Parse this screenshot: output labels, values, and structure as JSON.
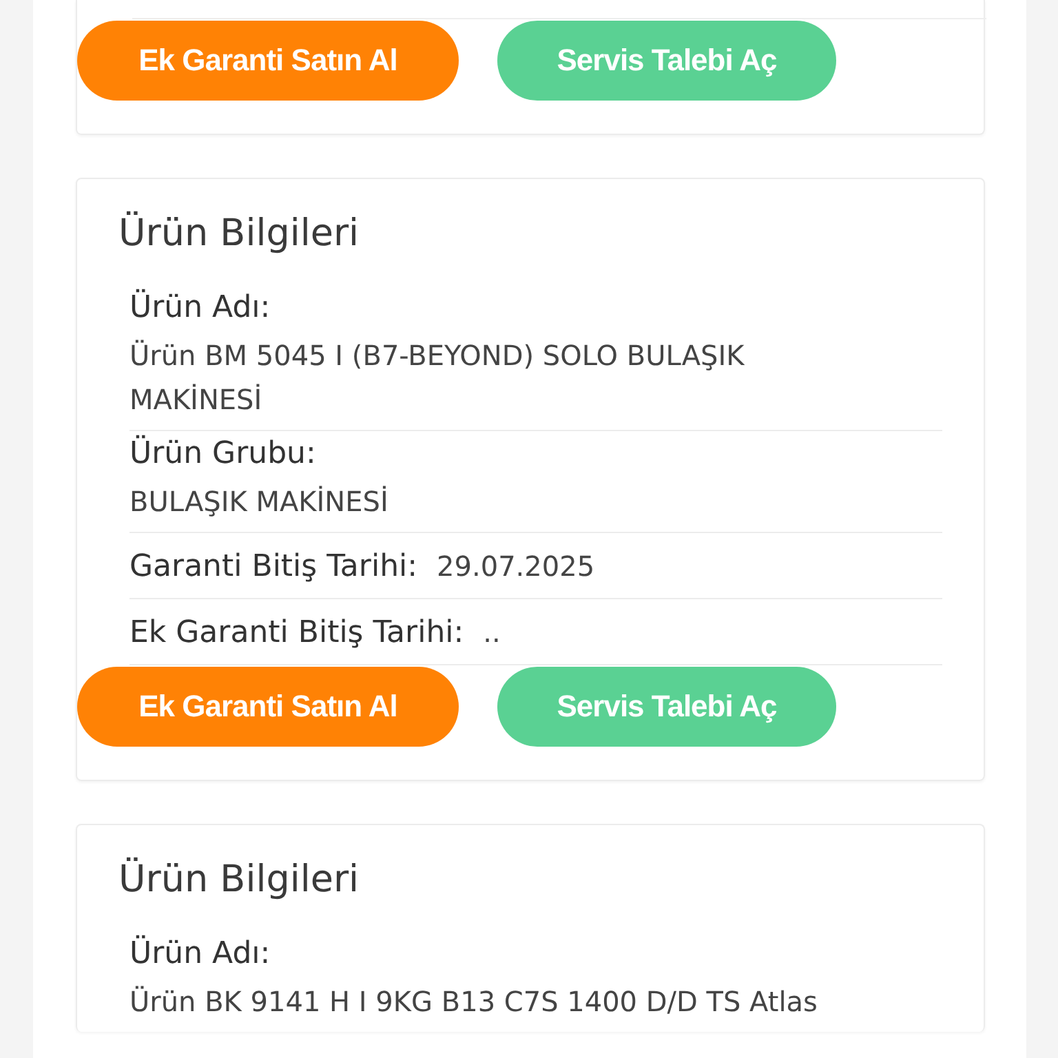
{
  "cards": [
    {
      "buttons": [
        {
          "label": "Ek Garanti Satın Al",
          "kind": "buy"
        },
        {
          "label": "Servis Talebi Aç",
          "kind": "service"
        }
      ]
    },
    {
      "title": "Ürün Bilgileri",
      "fields": [
        {
          "kind": "stacked",
          "label": "Ürün Adı:",
          "value": "Ürün BM 5045 I (B7-BEYOND) SOLO BULAŞIK MAKİNESİ"
        },
        {
          "kind": "stacked",
          "label": "Ürün Grubu:",
          "value": "BULAŞIK MAKİNESİ"
        },
        {
          "kind": "inline",
          "label": "Garanti Bitiş Tarihi:",
          "value": "29.07.2025"
        },
        {
          "kind": "inline",
          "label": "Ek Garanti Bitiş Tarihi:",
          "value": ".."
        }
      ],
      "buttons": [
        {
          "label": "Ek Garanti Satın Al",
          "kind": "buy"
        },
        {
          "label": "Servis Talebi Aç",
          "kind": "service"
        }
      ]
    },
    {
      "title": "Ürün Bilgileri",
      "fields": [
        {
          "kind": "stacked",
          "label": "Ürün Adı:",
          "value": "Ürün BK 9141 H I 9KG B13 C7S 1400 D/D TS Atlas"
        }
      ]
    }
  ]
}
